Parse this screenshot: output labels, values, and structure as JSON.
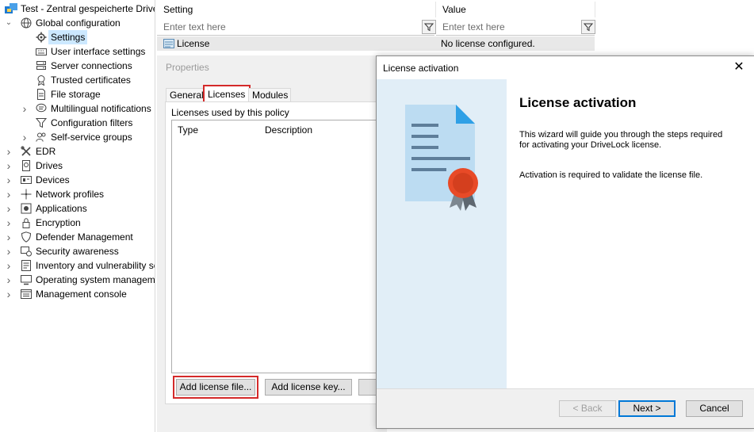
{
  "tree": {
    "root": "Test - Zentral gespeicherte DriveLock",
    "items": [
      {
        "label": "Global configuration",
        "icon": "globe-icon",
        "level": 1,
        "expander": "expanded"
      },
      {
        "label": "Settings",
        "icon": "gear-icon",
        "level": 2,
        "expander": "",
        "selected": true
      },
      {
        "label": "User interface settings",
        "icon": "keyboard-icon",
        "level": 2,
        "expander": ""
      },
      {
        "label": "Server connections",
        "icon": "server-icon",
        "level": 2,
        "expander": ""
      },
      {
        "label": "Trusted certificates",
        "icon": "certificate-icon",
        "level": 2,
        "expander": ""
      },
      {
        "label": "File storage",
        "icon": "file-icon",
        "level": 2,
        "expander": ""
      },
      {
        "label": "Multilingual notifications",
        "icon": "speech-icon",
        "level": 2,
        "expander": "collapsed"
      },
      {
        "label": "Configuration filters",
        "icon": "filter-icon",
        "level": 2,
        "expander": ""
      },
      {
        "label": "Self-service groups",
        "icon": "users-icon",
        "level": 2,
        "expander": "collapsed"
      },
      {
        "label": "EDR",
        "icon": "tools-icon",
        "level": 1,
        "expander": "collapsed"
      },
      {
        "label": "Drives",
        "icon": "drive-icon",
        "level": 1,
        "expander": "collapsed"
      },
      {
        "label": "Devices",
        "icon": "device-icon",
        "level": 1,
        "expander": "collapsed"
      },
      {
        "label": "Network profiles",
        "icon": "network-icon",
        "level": 1,
        "expander": "collapsed"
      },
      {
        "label": "Applications",
        "icon": "app-icon",
        "level": 1,
        "expander": "collapsed"
      },
      {
        "label": "Encryption",
        "icon": "lock-icon",
        "level": 1,
        "expander": "collapsed"
      },
      {
        "label": "Defender Management",
        "icon": "shield-icon",
        "level": 1,
        "expander": "collapsed"
      },
      {
        "label": "Security awareness",
        "icon": "awareness-icon",
        "level": 1,
        "expander": "collapsed"
      },
      {
        "label": "Inventory and vulnerability scan",
        "icon": "inventory-icon",
        "level": 1,
        "expander": "collapsed"
      },
      {
        "label": "Operating system management",
        "icon": "monitor-icon",
        "level": 1,
        "expander": "collapsed"
      },
      {
        "label": "Management console",
        "icon": "console-icon",
        "level": 1,
        "expander": "collapsed"
      }
    ]
  },
  "grid": {
    "col_setting": "Setting",
    "col_value": "Value",
    "filter_placeholder": "Enter text here",
    "row_setting": "License",
    "row_value": "No license configured."
  },
  "properties": {
    "title": "Properties",
    "tabs": [
      "General",
      "Licenses",
      "Modules"
    ],
    "licenses_label": "Licenses used by this policy",
    "col_type": "Type",
    "col_description": "Description",
    "add_file": "Add license file...",
    "add_key": "Add license key..."
  },
  "dialog": {
    "title": "License activation",
    "heading": "License activation",
    "text1": "This wizard will guide you through the steps required for activating your DriveLock license.",
    "text2": "Activation is required to validate the license file.",
    "back": "< Back",
    "next": "Next >",
    "cancel": "Cancel"
  },
  "colors": {
    "highlight": "#d42a2a",
    "selection": "#cce8ff",
    "wizard_panel": "#e1eef7",
    "primary_border": "#0078d7"
  }
}
